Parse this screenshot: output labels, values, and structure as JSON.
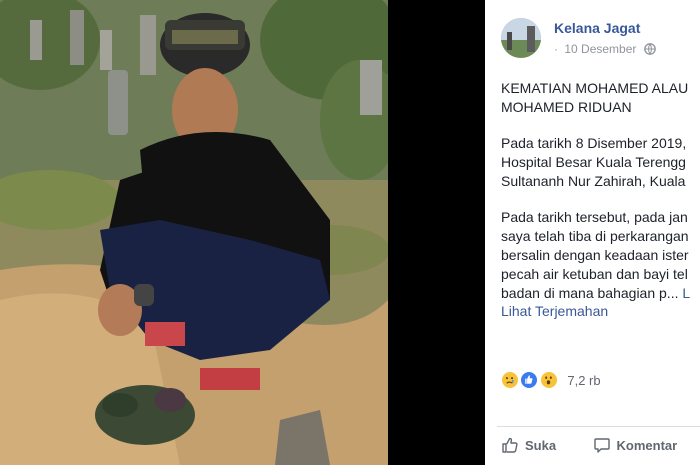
{
  "post": {
    "author": "Kelana Jagat",
    "date": "10 Desember",
    "date_prefix": "·",
    "privacy_icon": "globe-icon",
    "paragraphs": [
      [
        "KEMATIAN MOHAMED ALAU",
        "MOHAMED RIDUAN"
      ],
      [
        "Pada tarikh 8 Disember 2019,",
        "Hospital Besar Kuala Terengg",
        "Sultananh Nur Zahirah, Kuala"
      ],
      [
        "Pada tarikh tersebut, pada jan",
        "saya telah tiba di perkarangan",
        "bersalin dengan keadaan ister",
        "pecah air ketuban dan bayi tel",
        "badan di mana bahagian p..."
      ]
    ],
    "see_more": "L",
    "translate_label": "Lihat Terjemahan"
  },
  "reactions": {
    "icons": [
      "sad-reaction-icon",
      "like-reaction-icon",
      "wow-reaction-icon"
    ],
    "count": "7,2 rb"
  },
  "actions": {
    "like_label": "Suka",
    "comment_label": "Komentar"
  },
  "colors": {
    "link_blue": "#385898",
    "text": "#1d2129",
    "muted": "#90949c",
    "divider": "#dadde1"
  }
}
